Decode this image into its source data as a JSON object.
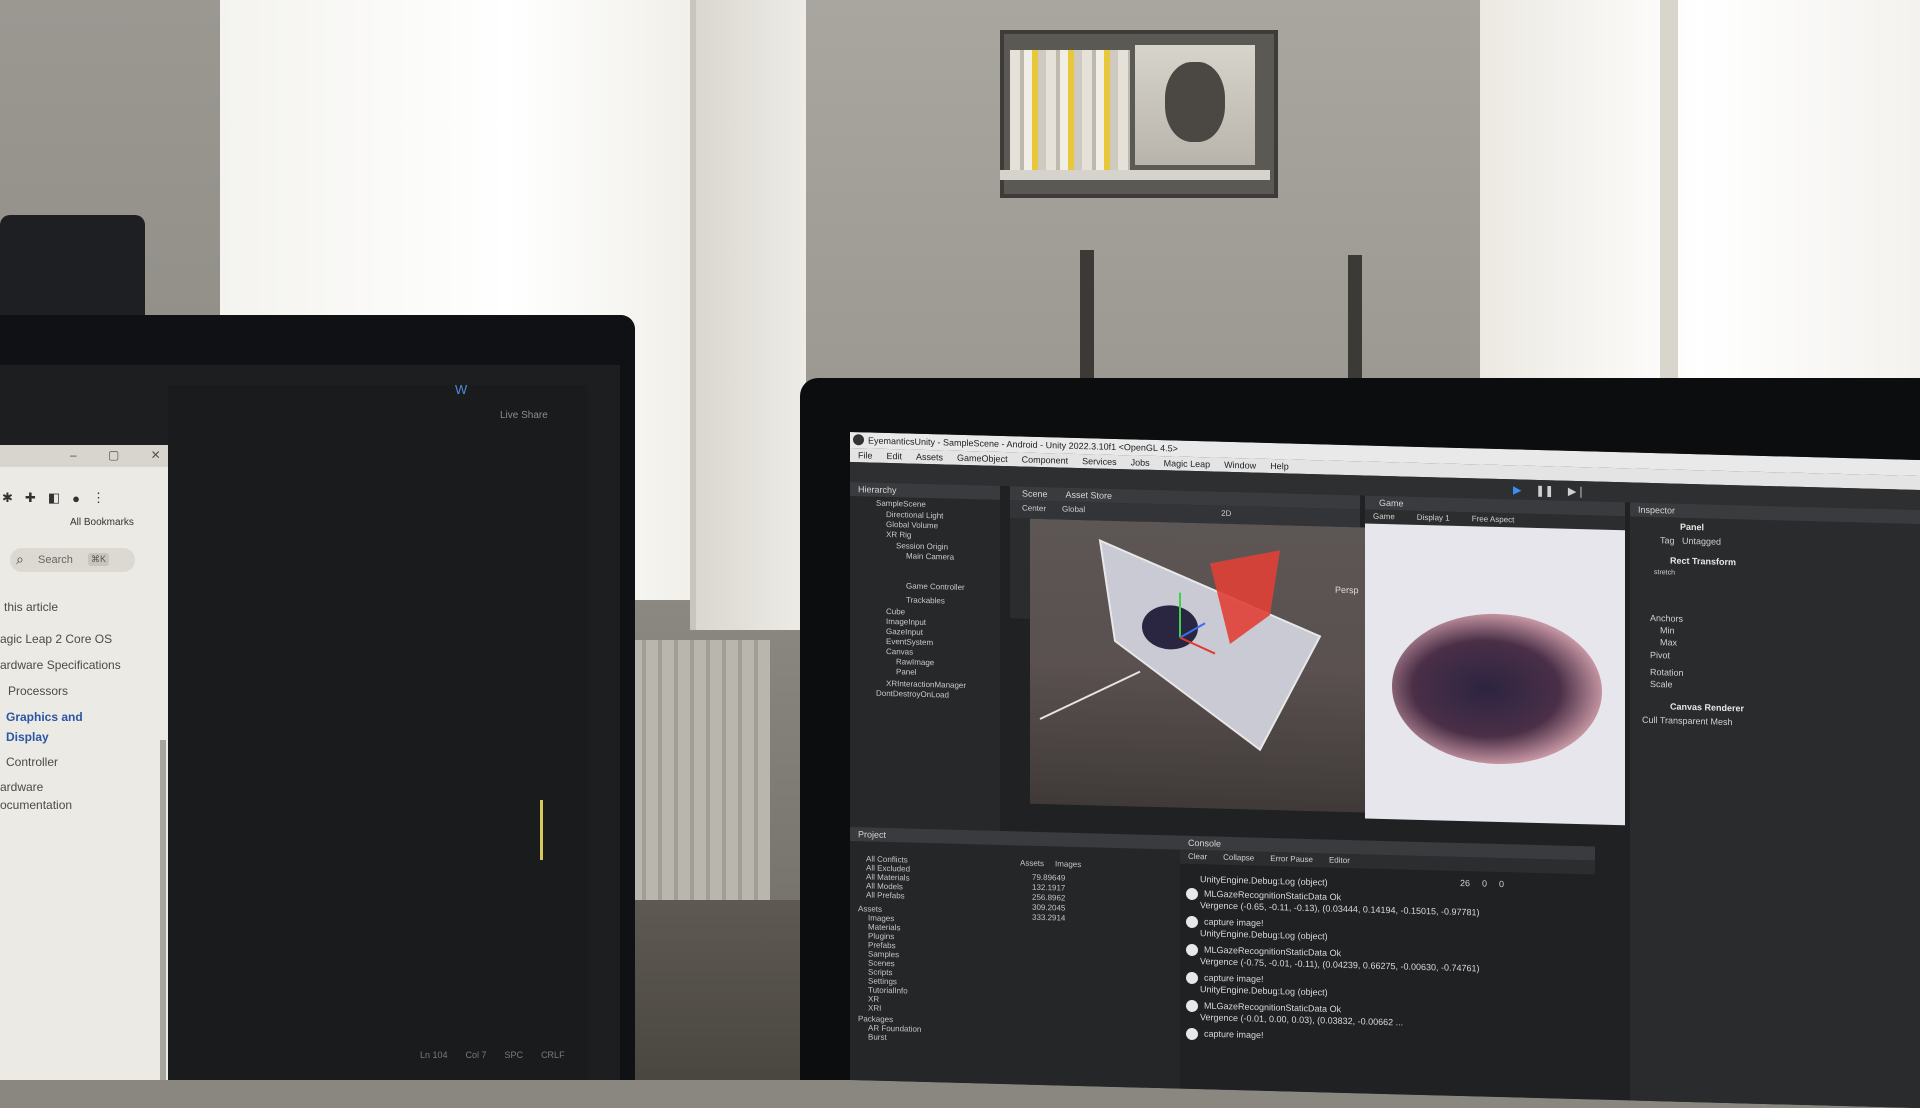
{
  "left_monitor": {
    "editor_logo": "W",
    "live_share": "Live Share",
    "status": [
      "Ln 104",
      "Col 7",
      "SPC",
      "CRLF"
    ],
    "browser": {
      "bookmarks": "All Bookmarks",
      "search_placeholder": "Search",
      "search_shortcut": "⌘K",
      "toc": [
        "this article",
        "agic Leap 2 Core OS",
        "ardware Specifications",
        "Processors",
        "Graphics and",
        "Display",
        "Controller",
        "ardware",
        "ocumentation"
      ]
    }
  },
  "unity": {
    "title": "EyemanticsUnity - SampleScene - Android - Unity 2022.3.10f1 <OpenGL 4.5>",
    "menu": [
      "File",
      "Edit",
      "Assets",
      "GameObject",
      "Component",
      "Services",
      "Jobs",
      "Magic Leap",
      "Window",
      "Help"
    ],
    "hierarchy": {
      "title": "Hierarchy",
      "items": [
        "SampleScene",
        "Directional Light",
        "Global Volume",
        "XR Rig",
        "Session Origin",
        "Main Camera",
        "Game Controller",
        "Trackables",
        "Cube",
        "ImageInput",
        "GazeInput",
        "EventSystem",
        "Canvas",
        "RawImage",
        "Panel",
        "XRInteractionManager",
        "DontDestroyOnLoad"
      ]
    },
    "scene": {
      "tabs": [
        "Scene",
        "Asset Store"
      ],
      "tools": [
        "Center",
        "Global",
        "2D"
      ],
      "persp": "Persp"
    },
    "game": {
      "tab": "Game",
      "bar": [
        "Game",
        "Display 1",
        "Free Aspect"
      ]
    },
    "inspector": {
      "title": "Inspector",
      "object": "Panel",
      "tag_label": "Tag",
      "tag": "Untagged",
      "component": "Rect Transform",
      "stretch": "stretch",
      "fields": [
        "Anchors",
        "Min",
        "Max",
        "Pivot",
        "Rotation",
        "Scale"
      ],
      "renderer": "Canvas Renderer",
      "cull": "Cull Transparent Mesh"
    },
    "project": {
      "title": "Project",
      "favorites": [
        "All Conflicts",
        "All Excluded",
        "All Materials",
        "All Models",
        "All Prefabs"
      ],
      "assets_header": "Assets",
      "assets": [
        "Images",
        "Materials",
        "Plugins",
        "Prefabs",
        "Samples",
        "Scenes",
        "Scripts",
        "Settings",
        "TutorialInfo",
        "XR",
        "XRI"
      ],
      "packages_header": "Packages",
      "packages": [
        "AR Foundation",
        "Burst"
      ],
      "breadcrumb": [
        "Assets",
        "Images"
      ],
      "files": [
        "79.89649",
        "132.1917",
        "256.8962",
        "309.2045",
        "333.2914"
      ]
    },
    "console": {
      "title": "Console",
      "buttons": [
        "Clear",
        "Collapse",
        "Error Pause",
        "Editor"
      ],
      "counts": [
        "26",
        "0",
        "0"
      ],
      "entries": [
        "UnityEngine.Debug:Log (object)",
        "MLGazeRecognitionStaticData Ok",
        "Vergence (-0.65, -0.11, -0.13), (0.03444, 0.14194, -0.15015, -0.97781)",
        "capture image!",
        "UnityEngine.Debug:Log (object)",
        "MLGazeRecognitionStaticData Ok",
        "Vergence (-0.75, -0.01, -0.11), (0.04239, 0.66275, -0.00630, -0.74761)",
        "capture image!",
        "UnityEngine.Debug:Log (object)",
        "MLGazeRecognitionStaticData Ok",
        "Vergence (-0.01, 0.00, 0.03), (0.03832, -0.00662 ...",
        "capture image!"
      ]
    }
  }
}
